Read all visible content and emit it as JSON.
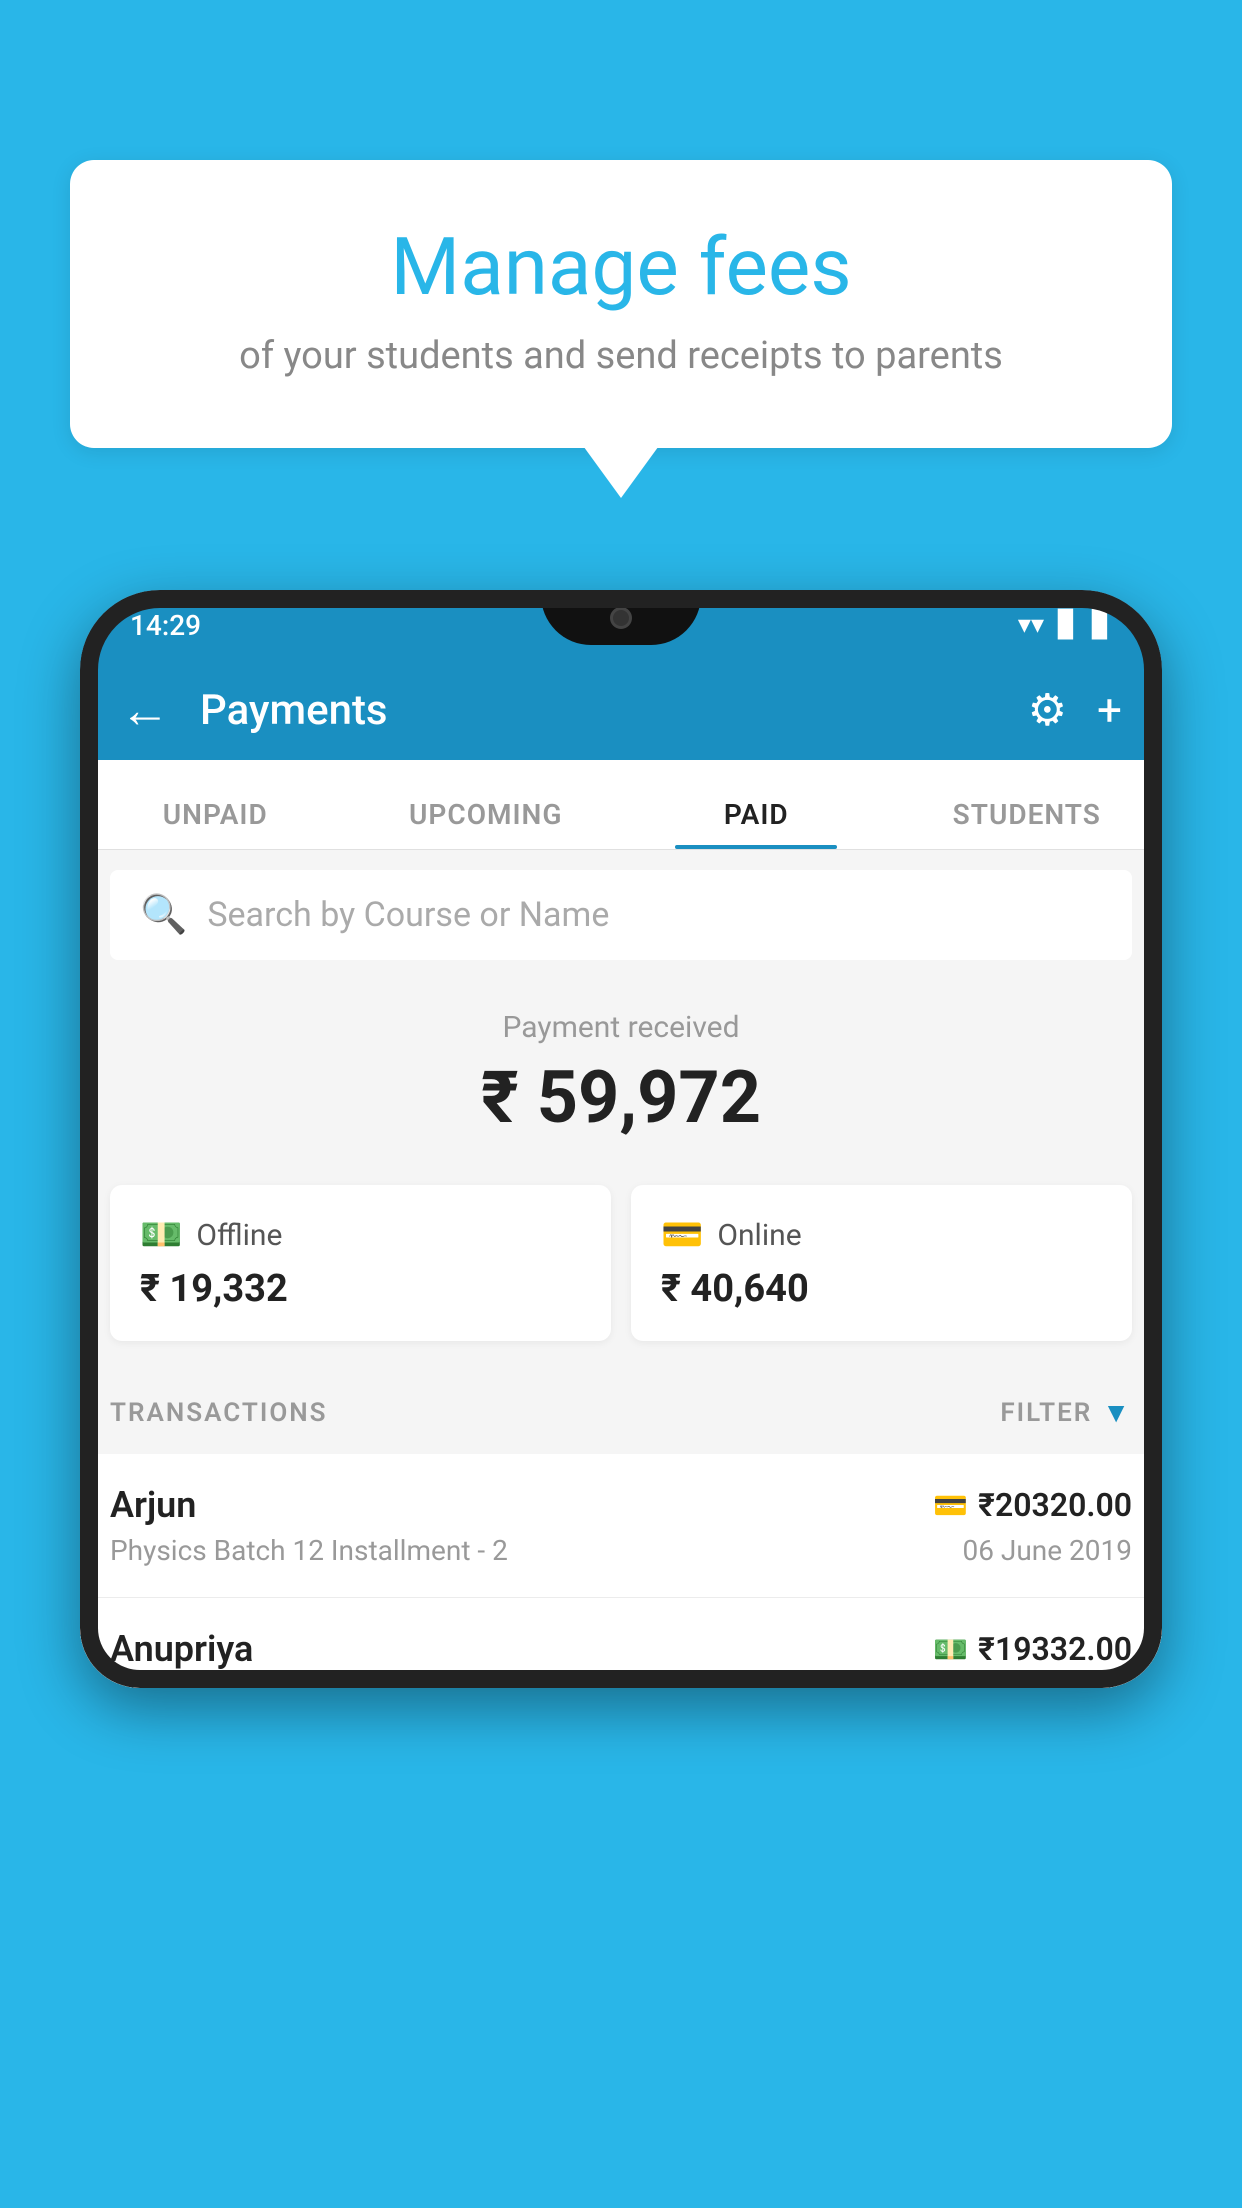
{
  "bubble": {
    "title": "Manage fees",
    "subtitle": "of your students and send receipts to parents"
  },
  "status_bar": {
    "time": "14:29",
    "wifi": "▲",
    "signal": "▲",
    "battery": "▊"
  },
  "app_bar": {
    "title": "Payments",
    "back_label": "←",
    "gear_label": "⚙",
    "plus_label": "+"
  },
  "tabs": [
    {
      "id": "unpaid",
      "label": "UNPAID",
      "active": false
    },
    {
      "id": "upcoming",
      "label": "UPCOMING",
      "active": false
    },
    {
      "id": "paid",
      "label": "PAID",
      "active": true
    },
    {
      "id": "students",
      "label": "STUDENTS",
      "active": false
    }
  ],
  "search": {
    "placeholder": "Search by Course or Name"
  },
  "payment_summary": {
    "received_label": "Payment received",
    "amount": "₹ 59,972",
    "offline": {
      "type": "Offline",
      "amount": "₹ 19,332"
    },
    "online": {
      "type": "Online",
      "amount": "₹ 40,640"
    }
  },
  "transactions": {
    "header_label": "TRANSACTIONS",
    "filter_label": "FILTER",
    "rows": [
      {
        "name": "Arjun",
        "amount": "₹20320.00",
        "course": "Physics Batch 12 Installment - 2",
        "date": "06 June 2019",
        "icon": "card"
      },
      {
        "name": "Anupriya",
        "amount": "₹19332.00",
        "course": "",
        "date": "",
        "icon": "cash"
      }
    ]
  }
}
